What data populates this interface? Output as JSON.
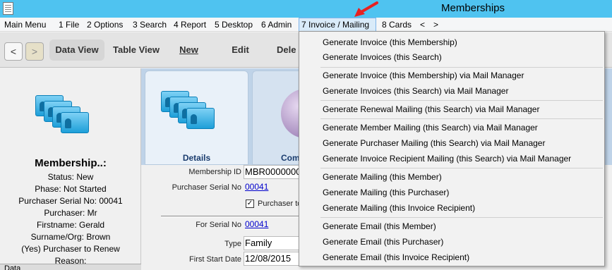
{
  "window": {
    "title": "Memberships"
  },
  "menubar": {
    "items": [
      {
        "label": "Main Menu"
      },
      {
        "label": "1 File"
      },
      {
        "label": "2 Options"
      },
      {
        "label": "3 Search"
      },
      {
        "label": "4 Report"
      },
      {
        "label": "5 Desktop"
      },
      {
        "label": "6 Admin"
      },
      {
        "label": "7 Invoice / Mailing"
      },
      {
        "label": "8 Cards"
      },
      {
        "label": "<"
      },
      {
        "label": ">"
      }
    ]
  },
  "toolbar": {
    "back": "<",
    "forward": ">",
    "data_view": "Data View",
    "table_view": "Table View",
    "new": "New",
    "edit": "Edit",
    "delete": "Dele"
  },
  "left_panel": {
    "title": "Membership..:",
    "lines": [
      "Status: New",
      "Phase: Not Started",
      "Purchaser Serial No: 00041",
      "Purchaser: Mr",
      "Firstname: Gerald",
      "Surname/Org: Brown",
      "(Yes) Purchaser to Renew",
      "Reason:"
    ],
    "bottom_label": "Data"
  },
  "tabs": {
    "details": "Details",
    "second": "Com"
  },
  "form": {
    "membership_id_label": "Membership ID",
    "membership_id_value": "MBR0000000",
    "purchaser_serial_label": "Purchaser Serial No",
    "purchaser_serial_value": "00041",
    "purchaser_to_label": "Purchaser to",
    "for_serial_label": "For Serial No",
    "for_serial_value": "00041",
    "type_label": "Type",
    "type_value": "Family",
    "first_start_label": "First Start Date",
    "first_start_value": "12/08/2015"
  },
  "dropdown": {
    "items": [
      "Generate Invoice (this Membership)",
      "Generate Invoices (this Search)",
      "Generate Invoice (this Membership) via Mail Manager",
      "Generate Invoices (this Search) via Mail Manager",
      "Generate Renewal Mailing (this Search) via Mail Manager",
      "Generate Member Mailing (this Search) via Mail Manager",
      "Generate Purchaser Mailing (this Search) via Mail Manager",
      "Generate Invoice Recipient Mailing (this Search) via Mail Manager",
      "Generate Mailing (this Member)",
      "Generate Mailing (this Purchaser)",
      "Generate Mailing (this Invoice Recipient)",
      "Generate Email (this Member)",
      "Generate Email (this Purchaser)",
      "Generate Email (this Invoice Recipient)"
    ]
  },
  "colors": {
    "titlebar": "#4fc3f0",
    "arrow": "#e82020",
    "link": "#0000cc"
  }
}
